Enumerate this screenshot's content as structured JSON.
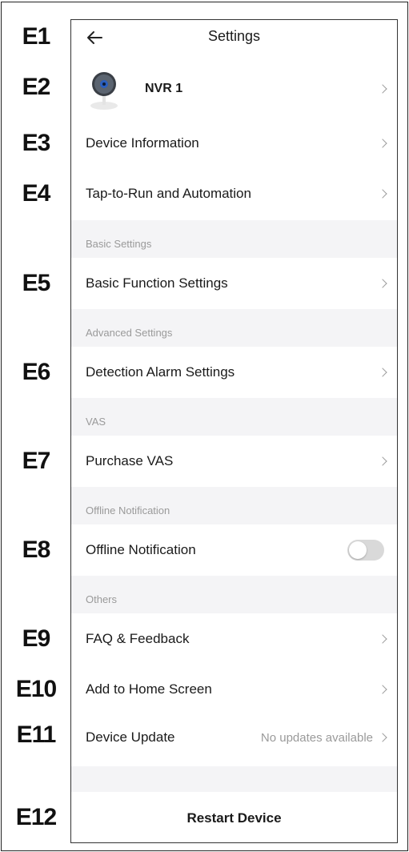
{
  "badges": [
    "E1",
    "E2",
    "E3",
    "E4",
    "E5",
    "E6",
    "E7",
    "E8",
    "E9",
    "E10",
    "E11",
    "E12"
  ],
  "header": {
    "title": "Settings",
    "back_icon": "arrow-left-icon"
  },
  "device": {
    "name": "NVR 1",
    "icon": "camera-icon"
  },
  "items": {
    "device_information": "Device Information",
    "tap_to_run": "Tap-to-Run and Automation",
    "basic_function": "Basic Function Settings",
    "detection_alarm": "Detection Alarm Settings",
    "purchase_vas": "Purchase VAS",
    "offline_notification": "Offline Notification",
    "faq_feedback": "FAQ & Feedback",
    "add_home_screen": "Add to Home Screen",
    "device_update": "Device Update",
    "device_update_value": "No updates available"
  },
  "sections": {
    "basic": "Basic Settings",
    "advanced": "Advanced Settings",
    "vas": "VAS",
    "offline": "Offline Notification",
    "others": "Others"
  },
  "offline_toggle_on": false,
  "restart_label": "Restart Device",
  "colors": {
    "section_bg": "#f4f4f6",
    "toggle_off": "#d9d9d9",
    "secondary_text": "#9a9a9a"
  }
}
